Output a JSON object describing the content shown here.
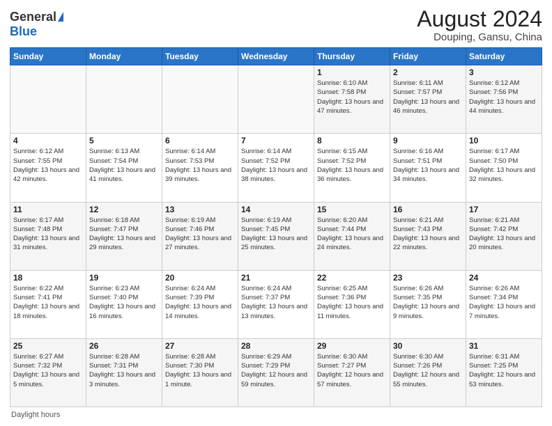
{
  "header": {
    "logo_general": "General",
    "logo_blue": "Blue",
    "main_title": "August 2024",
    "subtitle": "Douping, Gansu, China"
  },
  "calendar": {
    "days_of_week": [
      "Sunday",
      "Monday",
      "Tuesday",
      "Wednesday",
      "Thursday",
      "Friday",
      "Saturday"
    ],
    "weeks": [
      [
        {
          "day": "",
          "info": ""
        },
        {
          "day": "",
          "info": ""
        },
        {
          "day": "",
          "info": ""
        },
        {
          "day": "",
          "info": ""
        },
        {
          "day": "1",
          "info": "Sunrise: 6:10 AM\nSunset: 7:58 PM\nDaylight: 13 hours and 47 minutes."
        },
        {
          "day": "2",
          "info": "Sunrise: 6:11 AM\nSunset: 7:57 PM\nDaylight: 13 hours and 46 minutes."
        },
        {
          "day": "3",
          "info": "Sunrise: 6:12 AM\nSunset: 7:56 PM\nDaylight: 13 hours and 44 minutes."
        }
      ],
      [
        {
          "day": "4",
          "info": "Sunrise: 6:12 AM\nSunset: 7:55 PM\nDaylight: 13 hours and 42 minutes."
        },
        {
          "day": "5",
          "info": "Sunrise: 6:13 AM\nSunset: 7:54 PM\nDaylight: 13 hours and 41 minutes."
        },
        {
          "day": "6",
          "info": "Sunrise: 6:14 AM\nSunset: 7:53 PM\nDaylight: 13 hours and 39 minutes."
        },
        {
          "day": "7",
          "info": "Sunrise: 6:14 AM\nSunset: 7:52 PM\nDaylight: 13 hours and 38 minutes."
        },
        {
          "day": "8",
          "info": "Sunrise: 6:15 AM\nSunset: 7:52 PM\nDaylight: 13 hours and 36 minutes."
        },
        {
          "day": "9",
          "info": "Sunrise: 6:16 AM\nSunset: 7:51 PM\nDaylight: 13 hours and 34 minutes."
        },
        {
          "day": "10",
          "info": "Sunrise: 6:17 AM\nSunset: 7:50 PM\nDaylight: 13 hours and 32 minutes."
        }
      ],
      [
        {
          "day": "11",
          "info": "Sunrise: 6:17 AM\nSunset: 7:48 PM\nDaylight: 13 hours and 31 minutes."
        },
        {
          "day": "12",
          "info": "Sunrise: 6:18 AM\nSunset: 7:47 PM\nDaylight: 13 hours and 29 minutes."
        },
        {
          "day": "13",
          "info": "Sunrise: 6:19 AM\nSunset: 7:46 PM\nDaylight: 13 hours and 27 minutes."
        },
        {
          "day": "14",
          "info": "Sunrise: 6:19 AM\nSunset: 7:45 PM\nDaylight: 13 hours and 25 minutes."
        },
        {
          "day": "15",
          "info": "Sunrise: 6:20 AM\nSunset: 7:44 PM\nDaylight: 13 hours and 24 minutes."
        },
        {
          "day": "16",
          "info": "Sunrise: 6:21 AM\nSunset: 7:43 PM\nDaylight: 13 hours and 22 minutes."
        },
        {
          "day": "17",
          "info": "Sunrise: 6:21 AM\nSunset: 7:42 PM\nDaylight: 13 hours and 20 minutes."
        }
      ],
      [
        {
          "day": "18",
          "info": "Sunrise: 6:22 AM\nSunset: 7:41 PM\nDaylight: 13 hours and 18 minutes."
        },
        {
          "day": "19",
          "info": "Sunrise: 6:23 AM\nSunset: 7:40 PM\nDaylight: 13 hours and 16 minutes."
        },
        {
          "day": "20",
          "info": "Sunrise: 6:24 AM\nSunset: 7:39 PM\nDaylight: 13 hours and 14 minutes."
        },
        {
          "day": "21",
          "info": "Sunrise: 6:24 AM\nSunset: 7:37 PM\nDaylight: 13 hours and 13 minutes."
        },
        {
          "day": "22",
          "info": "Sunrise: 6:25 AM\nSunset: 7:36 PM\nDaylight: 13 hours and 11 minutes."
        },
        {
          "day": "23",
          "info": "Sunrise: 6:26 AM\nSunset: 7:35 PM\nDaylight: 13 hours and 9 minutes."
        },
        {
          "day": "24",
          "info": "Sunrise: 6:26 AM\nSunset: 7:34 PM\nDaylight: 13 hours and 7 minutes."
        }
      ],
      [
        {
          "day": "25",
          "info": "Sunrise: 6:27 AM\nSunset: 7:32 PM\nDaylight: 13 hours and 5 minutes."
        },
        {
          "day": "26",
          "info": "Sunrise: 6:28 AM\nSunset: 7:31 PM\nDaylight: 13 hours and 3 minutes."
        },
        {
          "day": "27",
          "info": "Sunrise: 6:28 AM\nSunset: 7:30 PM\nDaylight: 13 hours and 1 minute."
        },
        {
          "day": "28",
          "info": "Sunrise: 6:29 AM\nSunset: 7:29 PM\nDaylight: 12 hours and 59 minutes."
        },
        {
          "day": "29",
          "info": "Sunrise: 6:30 AM\nSunset: 7:27 PM\nDaylight: 12 hours and 57 minutes."
        },
        {
          "day": "30",
          "info": "Sunrise: 6:30 AM\nSunset: 7:26 PM\nDaylight: 12 hours and 55 minutes."
        },
        {
          "day": "31",
          "info": "Sunrise: 6:31 AM\nSunset: 7:25 PM\nDaylight: 12 hours and 53 minutes."
        }
      ]
    ]
  },
  "footer": {
    "daylight_label": "Daylight hours"
  }
}
